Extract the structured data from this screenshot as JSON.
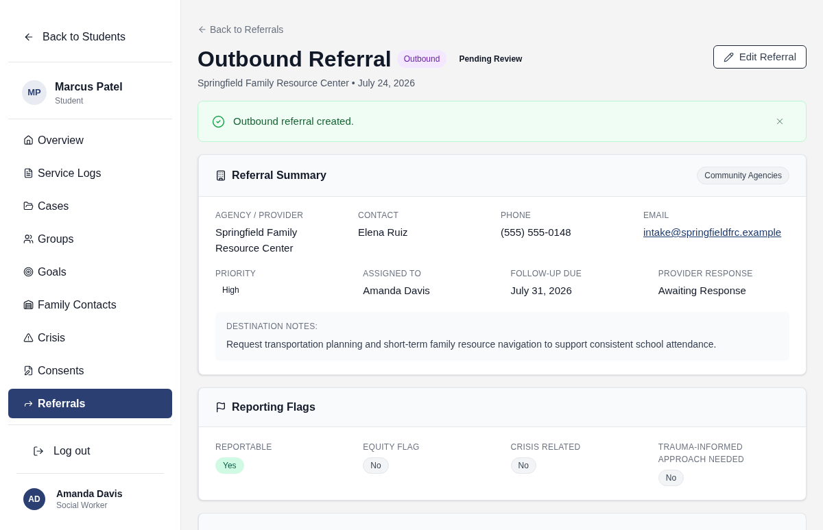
{
  "sidebar": {
    "back_link": "Back to Students",
    "student": {
      "initials": "MP",
      "name": "Marcus Patel",
      "role": "Student"
    },
    "nav_items": [
      {
        "label": "Overview",
        "selected": false
      },
      {
        "label": "Service Logs",
        "selected": false
      },
      {
        "label": "Cases",
        "selected": false
      },
      {
        "label": "Groups",
        "selected": false
      },
      {
        "label": "Goals",
        "selected": false
      },
      {
        "label": "Family Contacts",
        "selected": false
      },
      {
        "label": "Crisis",
        "selected": false
      },
      {
        "label": "Consents",
        "selected": false
      },
      {
        "label": "Referrals",
        "selected": true
      }
    ],
    "logout": "Log out",
    "user": {
      "initials": "AD",
      "name": "Amanda Davis",
      "role": "Social Worker"
    }
  },
  "header": {
    "back_link": "Back to Referrals",
    "title": "Outbound Referral",
    "badges": [
      {
        "label": "Outbound",
        "kind": "tag"
      },
      {
        "label": "Pending Review",
        "kind": "plain"
      }
    ],
    "subtitle": "Springfield Family Resource Center • July 24, 2026",
    "edit_button": "Edit Referral"
  },
  "alert": {
    "message": "Outbound referral created."
  },
  "summary_card": {
    "title": "Referral Summary",
    "tag": "Community Agencies",
    "fields_row_1": [
      {
        "label": "AGENCY / PROVIDER",
        "value": "Springfield Family Resource Center",
        "kind": "text"
      },
      {
        "label": "CONTACT",
        "value": "Elena Ruiz",
        "kind": "text"
      },
      {
        "label": "PHONE",
        "value": "(555) 555-0148",
        "kind": "text"
      },
      {
        "label": "EMAIL",
        "value": "intake@springfieldfrc.example",
        "kind": "link"
      }
    ],
    "fields_row_2": [
      {
        "label": "PRIORITY",
        "value": "High",
        "kind": "chip"
      },
      {
        "label": "ASSIGNED TO",
        "value": "Amanda Davis",
        "kind": "text"
      },
      {
        "label": "FOLLOW-UP DUE",
        "value": "July 31, 2026",
        "kind": "text"
      },
      {
        "label": "PROVIDER RESPONSE",
        "value": "Awaiting Response",
        "kind": "text"
      }
    ],
    "notes": {
      "label": "DESTINATION NOTES:",
      "text": "Request transportation planning and short-term family resource navigation to support consistent school attendance."
    }
  },
  "flags_card": {
    "title": "Reporting Flags",
    "flags": [
      {
        "label": "REPORTABLE",
        "value": "Yes",
        "on": true
      },
      {
        "label": "EQUITY FLAG",
        "value": "No",
        "on": false
      },
      {
        "label": "CRISIS RELATED",
        "value": "No",
        "on": false
      },
      {
        "label": "TRAUMA-INFORMED APPROACH NEEDED",
        "value": "No",
        "on": false
      }
    ]
  }
}
